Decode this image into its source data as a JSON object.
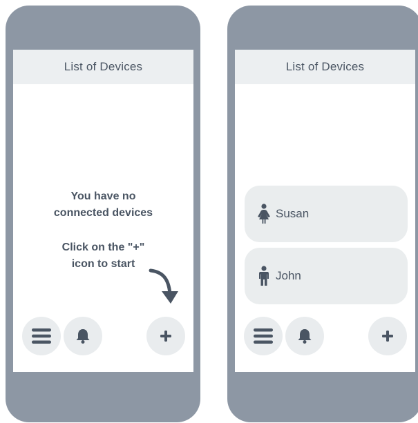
{
  "colors": {
    "phone_frame": "#8d97a4",
    "screen_bg": "#ffffff",
    "header_bg": "#eceff1",
    "text": "#4a5563",
    "button_bg": "#e9ecee",
    "card_bg": "#eaedee"
  },
  "screens": [
    {
      "header": {
        "title": "List of Devices"
      },
      "empty_state": {
        "line1": "You have no",
        "line2": "connected devices",
        "line3": "Click on the \"+\"",
        "line4": "icon to start"
      },
      "nav": {
        "menu_icon": "menu-icon",
        "bell_icon": "bell-icon",
        "add_icon": "plus-icon"
      }
    },
    {
      "header": {
        "title": "List of Devices"
      },
      "devices": [
        {
          "name": "Susan",
          "icon": "female-person-icon"
        },
        {
          "name": "John",
          "icon": "male-person-icon"
        }
      ],
      "nav": {
        "menu_icon": "menu-icon",
        "bell_icon": "bell-icon",
        "add_icon": "plus-icon"
      }
    }
  ]
}
